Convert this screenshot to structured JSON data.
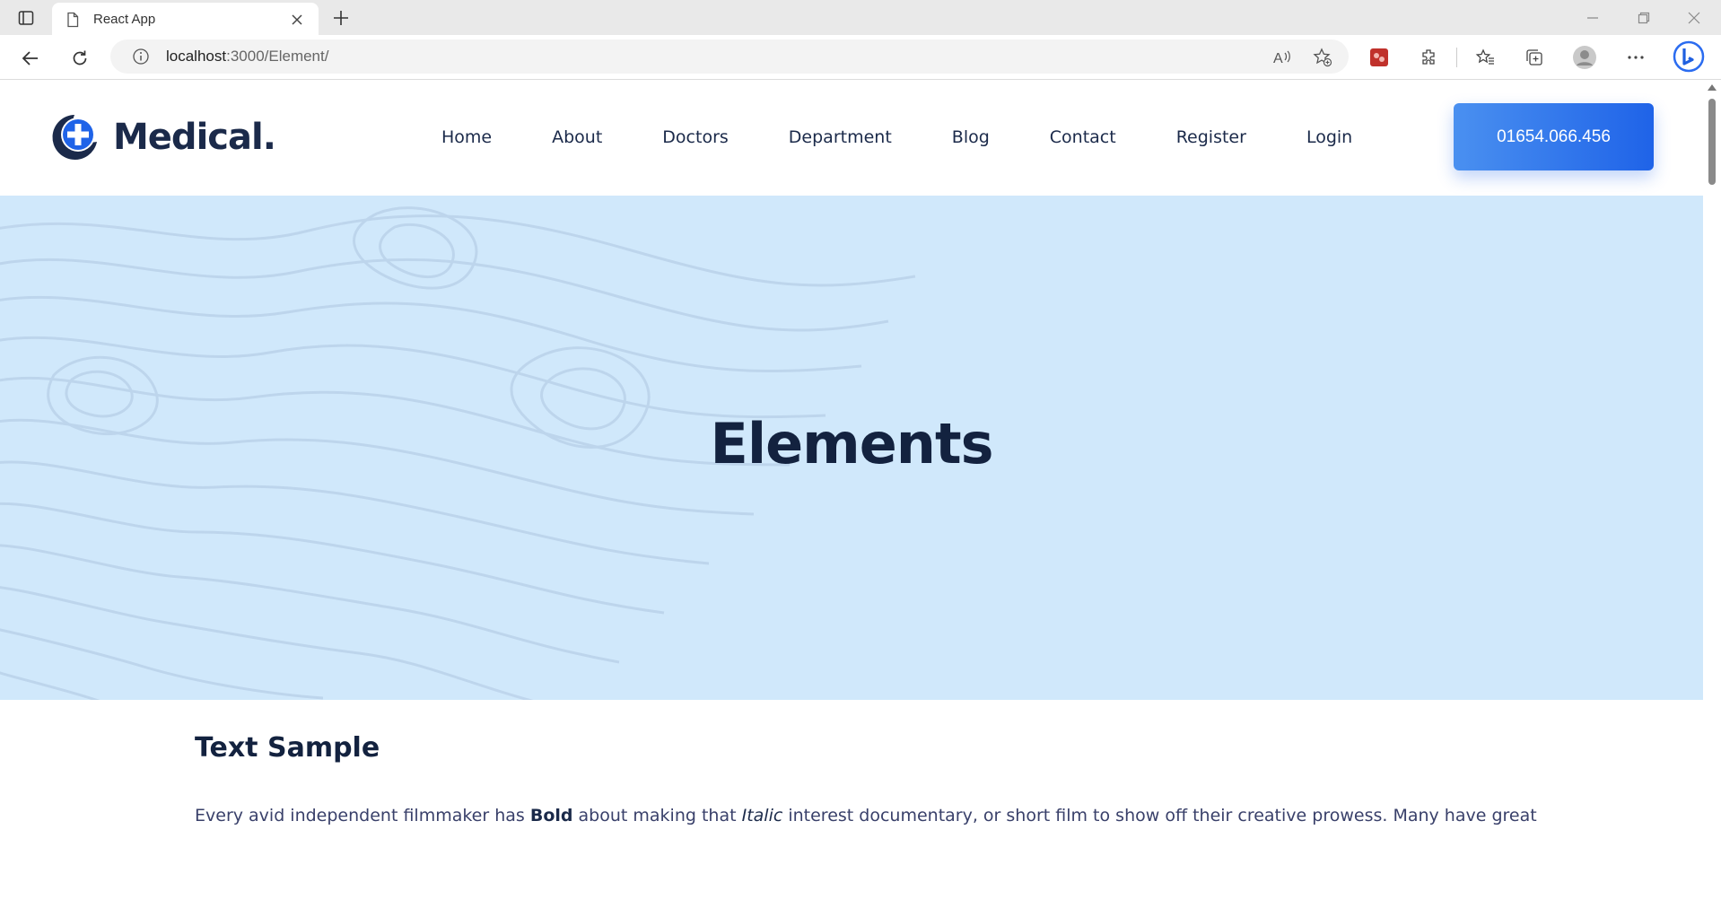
{
  "browser": {
    "tab_title": "React App",
    "url_host": "localhost",
    "url_path": ":3000/Element/"
  },
  "site": {
    "logo_text": "Medical",
    "logo_dot": ".",
    "nav": [
      "Home",
      "About",
      "Doctors",
      "Department",
      "Blog",
      "Contact",
      "Register",
      "Login"
    ],
    "phone": "01654.066.456",
    "accent_color": "#1f63e8",
    "hero_bg": "#d0e8fb"
  },
  "hero": {
    "title": "Elements"
  },
  "text_sample": {
    "heading": "Text Sample",
    "part1": "Every avid independent filmmaker has ",
    "bold": "Bold",
    "part2": " about making that ",
    "italic": "Italic",
    "part3": " interest documentary, or short film to show off their creative prowess. Many have great"
  }
}
